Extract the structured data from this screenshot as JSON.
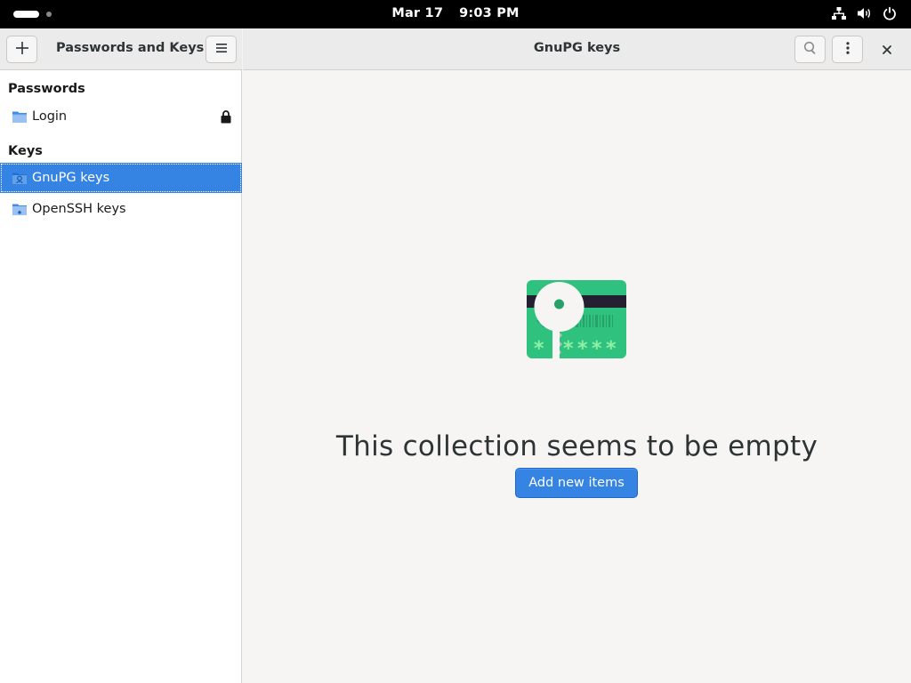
{
  "system_bar": {
    "date": "Mar 17",
    "time": "9:03 PM",
    "tray_icons": [
      "network-icon",
      "volume-icon",
      "power-icon"
    ]
  },
  "sidebar": {
    "title": "Passwords and Keys",
    "add_button_icon": "plus-icon",
    "menu_button_icon": "hamburger-menu-icon",
    "sections": [
      {
        "title": "Passwords",
        "items": [
          {
            "label": "Login",
            "icon": "folder-icon",
            "locked": true
          }
        ]
      },
      {
        "title": "Keys",
        "items": [
          {
            "label": "GnuPG keys",
            "icon": "gnupg-folder-icon",
            "selected": true
          },
          {
            "label": "OpenSSH keys",
            "icon": "ssh-folder-icon"
          }
        ]
      }
    ]
  },
  "main": {
    "title": "GnuPG keys",
    "search_button_icon": "search-icon",
    "more_button_icon": "kebab-menu-icon",
    "close_button_icon": "close-icon",
    "empty_state": {
      "illustration": "key-card-icon",
      "message": "This collection seems to be empty",
      "button_label": "Add new items"
    }
  },
  "colors": {
    "accent": "#3584e4",
    "card_green": "#2ec27e",
    "card_stripe": "#241f31"
  }
}
